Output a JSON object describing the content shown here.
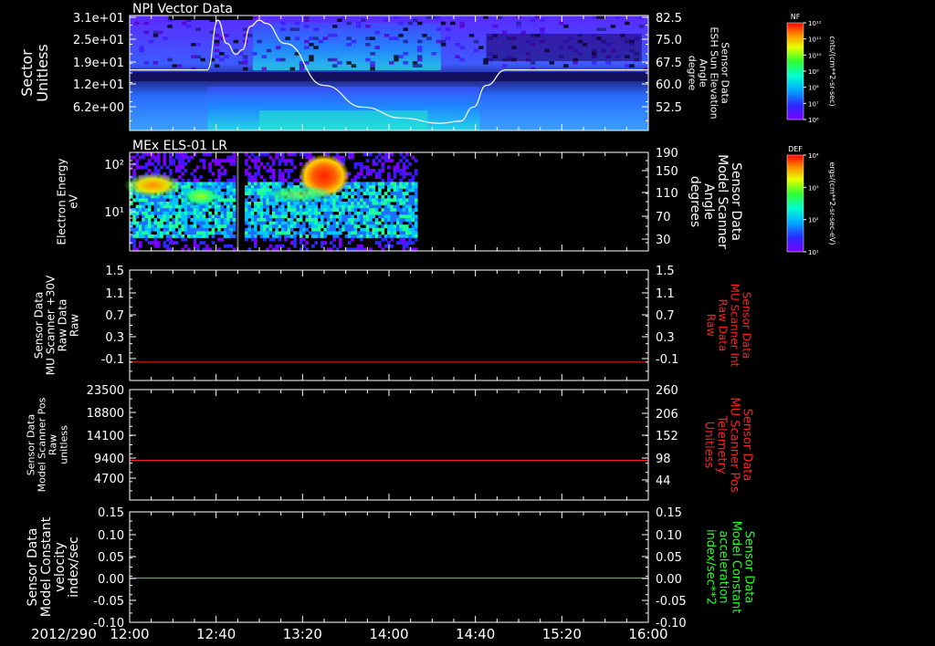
{
  "figure": {
    "date_label": "2012/290",
    "time_ticks": [
      "12:00",
      "12:40",
      "13:20",
      "14:00",
      "14:40",
      "15:20",
      "16:00"
    ],
    "colors": {
      "background": "#000000",
      "axes": "#ffffff",
      "red": "#ff2020",
      "green": "#20ff20"
    }
  },
  "chart_data": [
    {
      "type": "heatmap",
      "title": "NPI Vector Data",
      "ylabel": [
        "Sector",
        "Unitless"
      ],
      "yticks": [
        "3.1e+01",
        "2.5e+01",
        "1.9e+01",
        "1.2e+01",
        "6.2e+00"
      ],
      "right_label": [
        "Sensor Data",
        "ESH Sun Elevation",
        "Angle",
        "degree"
      ],
      "right_ticks": [
        "82.5",
        "75.0",
        "67.5",
        "60.0",
        "52.5"
      ],
      "right_range": [
        46,
        83
      ],
      "x_range_hours": [
        12.0,
        16.0
      ],
      "overlay_series": {
        "name": "ESH Sun Elevation Angle",
        "color": "#ffffff",
        "t_hours": [
          12.0,
          12.6,
          12.68,
          12.75,
          12.82,
          12.87,
          12.93,
          13.0,
          13.05,
          13.2,
          13.5,
          13.8,
          14.1,
          14.4,
          14.55,
          14.65,
          14.75,
          14.9,
          16.0
        ],
        "values": [
          65.5,
          65.5,
          81.5,
          74.0,
          70.5,
          72.0,
          79.5,
          81.5,
          80.5,
          74.0,
          60.5,
          53.5,
          50.0,
          48.3,
          49.0,
          53.5,
          60.5,
          65.5,
          65.5
        ]
      },
      "colorbar": {
        "label": "NF",
        "units": "cnts/(cm**2-sr-sec)",
        "tick_labels": [
          "10¹²",
          "10¹¹",
          "10¹⁰",
          "10⁹",
          "10⁸",
          "10⁷",
          "10⁶"
        ]
      }
    },
    {
      "type": "heatmap",
      "title": "MEx ELS-01 LR",
      "ylabel": [
        "Electron Energy",
        "eV"
      ],
      "yticks": [
        "10²",
        "10¹"
      ],
      "right_label": [
        "Sensor Data",
        "Model Scanner",
        "Angle",
        "degrees"
      ],
      "right_ticks": [
        "190",
        "150",
        "110",
        "70",
        "30"
      ],
      "right_range": [
        10,
        190
      ],
      "x_range_hours": [
        12.0,
        16.0
      ],
      "data_end_hours": 14.22,
      "gap_hours": [
        12.82,
        12.87
      ],
      "overlay_series": {
        "name": "Model Scanner Angle",
        "color": "#ffffff",
        "t_hours": [
          12.0,
          16.0
        ],
        "values": [
          10,
          10
        ]
      },
      "colorbar": {
        "label": "DEF",
        "units": "ergs/(cm**2-sr-sec-eV)",
        "tick_labels": [
          "10⁴",
          "10³",
          "10²",
          "10¹"
        ]
      }
    },
    {
      "type": "line",
      "ylabel": [
        "Sensor Data",
        "MU Scanner +30V",
        "Raw Data",
        "Raw"
      ],
      "yticks": [
        "1.5",
        "1.1",
        "0.7",
        "0.3",
        "-0.1"
      ],
      "ylim": [
        -0.3,
        1.5
      ],
      "right_label": [
        "Sensor Data",
        "MU Scanner Int",
        "Raw Data",
        "Raw"
      ],
      "right_ticks": [
        "1.5",
        "1.1",
        "0.7",
        "0.3",
        "-0.1"
      ],
      "right_ylim": [
        -0.3,
        1.5
      ],
      "series": [
        {
          "name": "MU Scanner Int",
          "color": "#ff2020",
          "axis": "right",
          "t_hours": [
            12.0,
            16.0
          ],
          "values": [
            0.0,
            0.0
          ]
        }
      ]
    },
    {
      "type": "line",
      "ylabel": [
        "Sensor Data",
        "Model Scanner Pos",
        "Raw",
        "unitless"
      ],
      "yticks": [
        "23500",
        "18800",
        "14100",
        "9400",
        "4700"
      ],
      "ylim": [
        0,
        23500
      ],
      "right_label": [
        "Sensor Data",
        "MU Scanner Pos",
        "Telemetry",
        "Unitless"
      ],
      "right_ticks": [
        "260",
        "206",
        "152",
        "98",
        "44"
      ],
      "right_ylim": [
        -10,
        260
      ],
      "series": [
        {
          "name": "MU Scanner Pos Telemetry",
          "color": "#ff2020",
          "axis": "right",
          "t_hours": [
            12.0,
            16.0
          ],
          "values": [
            87,
            87
          ]
        }
      ]
    },
    {
      "type": "line",
      "ylabel": [
        "Sensor Data",
        "Model Constant",
        "velocity",
        "index/sec"
      ],
      "yticks": [
        "0.15",
        "0.10",
        "0.05",
        "0.00",
        "-0.05",
        "-0.10"
      ],
      "ylim": [
        -0.1,
        0.15
      ],
      "right_label": [
        "Sensor Data",
        "Model Constant",
        "acceleration",
        "index/sec**2"
      ],
      "right_ticks": [
        "0.15",
        "0.10",
        "0.05",
        "0.00",
        "-0.05",
        "-0.10"
      ],
      "right_ylim": [
        -0.1,
        0.15
      ],
      "series": [
        {
          "name": "Model Constant acceleration",
          "color": "#20ff20",
          "axis": "right",
          "t_hours": [
            12.0,
            16.0
          ],
          "values": [
            0.0,
            0.0
          ]
        }
      ]
    }
  ]
}
